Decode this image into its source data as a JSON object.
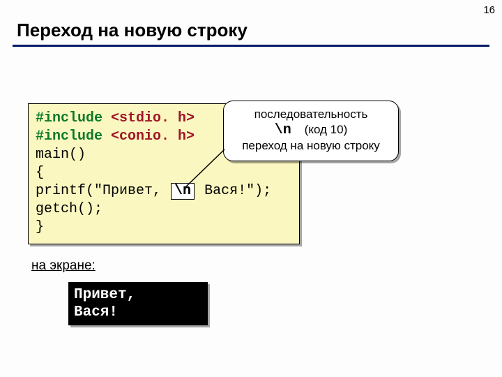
{
  "page_number": "16",
  "title": "Переход на новую строку",
  "code": {
    "include_kw": "#include",
    "hdr1": "<stdio. h>",
    "hdr2": "<conio. h>",
    "main": "main()",
    "brace_open": "{",
    "printf_pre": "printf(\"Привет,",
    "escape": "\\n",
    "printf_post": " Вася!\");",
    "getch": "getch();",
    "brace_close": "}"
  },
  "callout": {
    "line1": "последовательность",
    "escape": "\\n",
    "code_note": "(код 10)",
    "line3": "переход на новую строку"
  },
  "screen_label": "на экране:",
  "console_output": "Привет,\nВася!"
}
